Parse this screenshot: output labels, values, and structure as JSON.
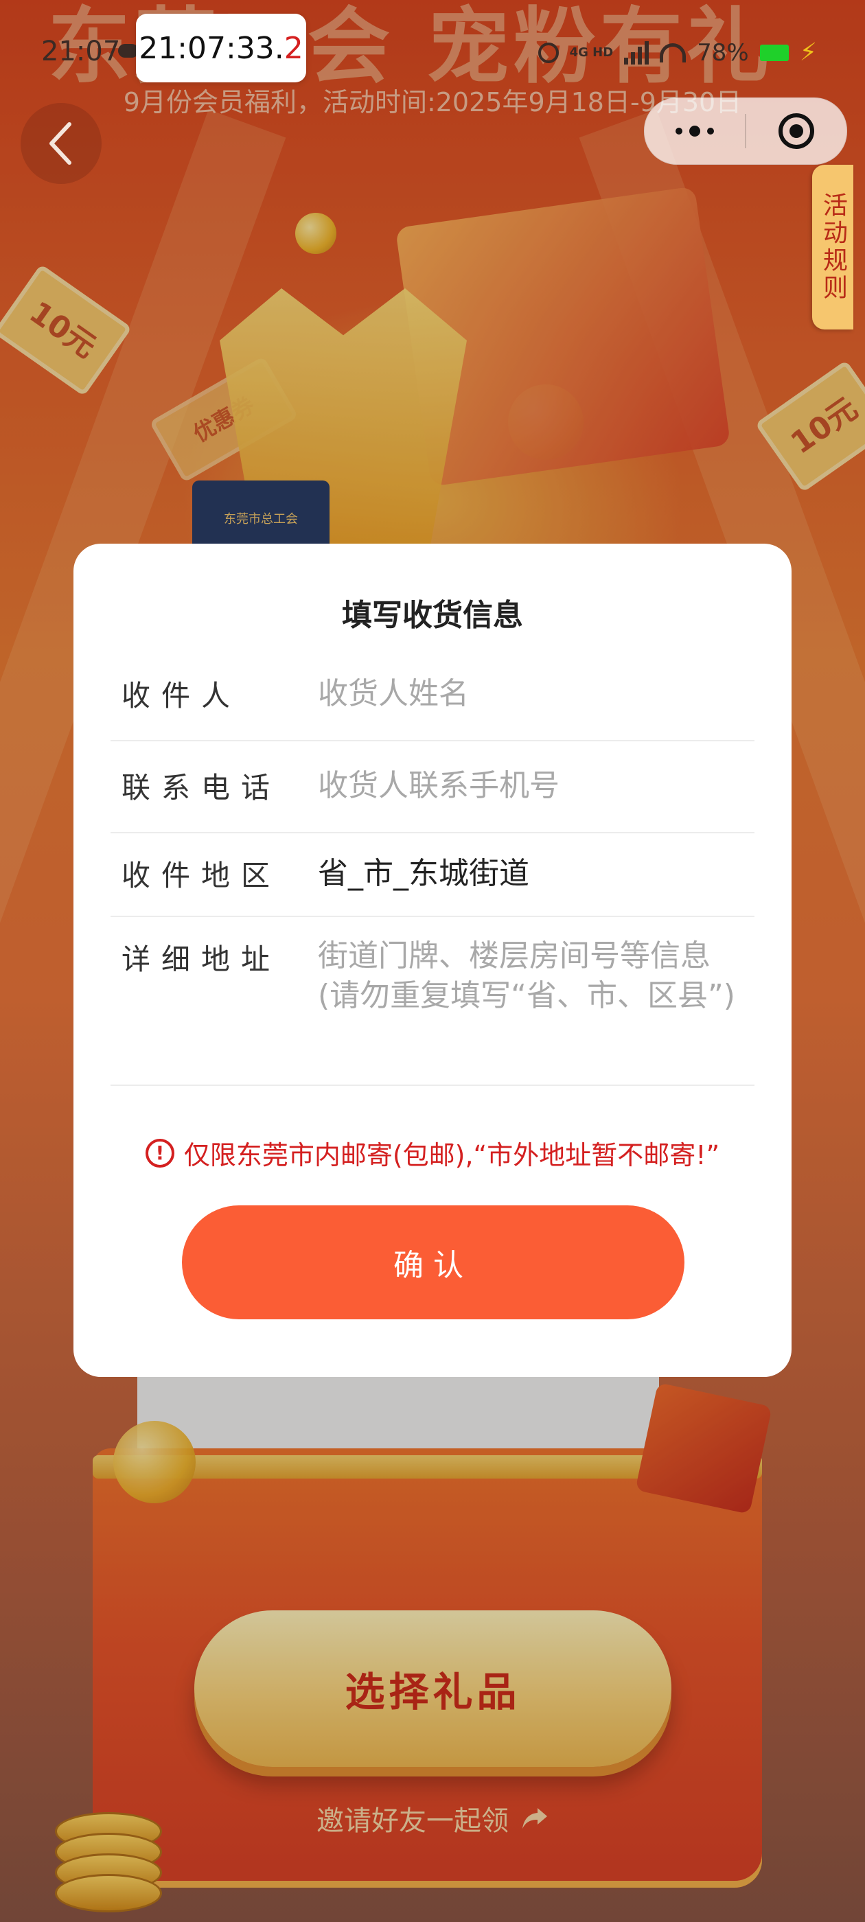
{
  "status_bar": {
    "time": "21:07",
    "clock_overlay": {
      "main": "21:07:33.",
      "tail": "2"
    },
    "network": "4G HD",
    "battery": "78%"
  },
  "background": {
    "headline": "东莞工会 宠粉有礼",
    "subtitle": "9月份会员福利，活动时间:2025年9月18日-9月30日",
    "ticket_left": "10元",
    "ticket_right": "10元",
    "coupon_text": "优惠券",
    "badge_text": "东莞市总工会"
  },
  "nav": {
    "rules_tab": "活动规则"
  },
  "modal": {
    "title": "填写收货信息",
    "fields": [
      {
        "label": "收件人",
        "value": "收货人姓名",
        "is_placeholder": true
      },
      {
        "label": "联系电话",
        "value": "收货人联系手机号",
        "is_placeholder": true
      },
      {
        "label": "收件地区",
        "value": "省_市_东城街道",
        "is_placeholder": false
      },
      {
        "label": "详细地址",
        "value": "街道门牌、楼层房间号等信息(请勿重复填写“省、市、区县”)",
        "is_placeholder": true
      }
    ],
    "notice": "仅限东莞市内邮寄(包邮),“市外地址暂不邮寄!”",
    "confirm_label": "确认"
  },
  "main": {
    "select_gift_label": "选择礼品",
    "invite_label": "邀请好友一起领"
  },
  "colors": {
    "primary_button": "#fb5d35",
    "notice": "#d42020",
    "gift_button_text": "#cf2d1a"
  },
  "icons": [
    "back-chevron-icon",
    "more-icon",
    "target-icon",
    "warning-circle-icon",
    "share-arrow-icon"
  ]
}
